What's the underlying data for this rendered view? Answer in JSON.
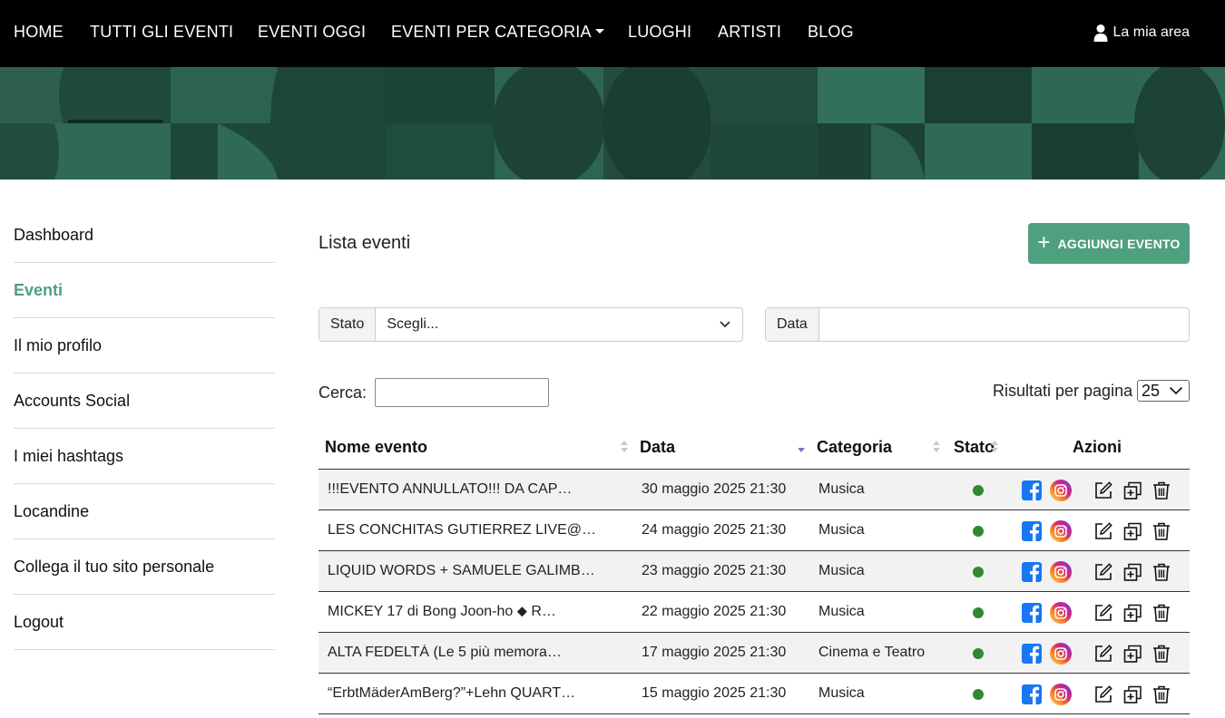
{
  "nav": {
    "items": [
      "HOME",
      "TUTTI GLI EVENTI",
      "EVENTI OGGI",
      "EVENTI PER CATEGORIA",
      "LUOGHI",
      "ARTISTI",
      "BLOG"
    ],
    "user_area": "La mia area"
  },
  "sidebar": {
    "items": [
      "Dashboard",
      "Eventi",
      "Il mio profilo",
      "Accounts Social",
      "I miei hashtags",
      "Locandine",
      "Collega il tuo sito personale",
      "Logout"
    ],
    "active": "Eventi"
  },
  "main": {
    "title": "Lista eventi",
    "add_button": "AGGIUNGI EVENTO",
    "filters": {
      "stato_label": "Stato",
      "stato_value": "Scegli...",
      "data_label": "Data",
      "data_value": ""
    },
    "search_label": "Cerca:",
    "per_page_label": "Risultati per pagina",
    "per_page_value": "25"
  },
  "table": {
    "headers": [
      "Nome evento",
      "Data",
      "Categoria",
      "Stato",
      "Azioni"
    ],
    "rows": [
      {
        "name": "!!!EVENTO ANNULLATO!!! DA CAP…",
        "date": "30 maggio 2025 21:30",
        "category": "Musica"
      },
      {
        "name": "LES CONCHITAS GUTIERREZ LIVE@…",
        "date": "24 maggio 2025 21:30",
        "category": "Musica"
      },
      {
        "name": "LIQUID WORDS + SAMUELE GALIMB…",
        "date": "23 maggio 2025 21:30",
        "category": "Musica"
      },
      {
        "name": "MICKEY 17 di Bong Joon-ho ⬥ R…",
        "date": "22 maggio 2025 21:30",
        "category": "Musica"
      },
      {
        "name": "ALTA FEDELTÀ (Le 5 più memora…",
        "date": "17 maggio 2025 21:30",
        "category": "Cinema e Teatro"
      },
      {
        "name": "“ErbtMäderAmBerg?”+Lehn QUART…",
        "date": "15 maggio 2025 21:30",
        "category": "Musica"
      }
    ]
  },
  "colors": {
    "accent": "#4fa07f",
    "navbar": "#000000",
    "hero": "#2e6450",
    "status_active": "#2f8a2f",
    "facebook": "#1877f2"
  }
}
